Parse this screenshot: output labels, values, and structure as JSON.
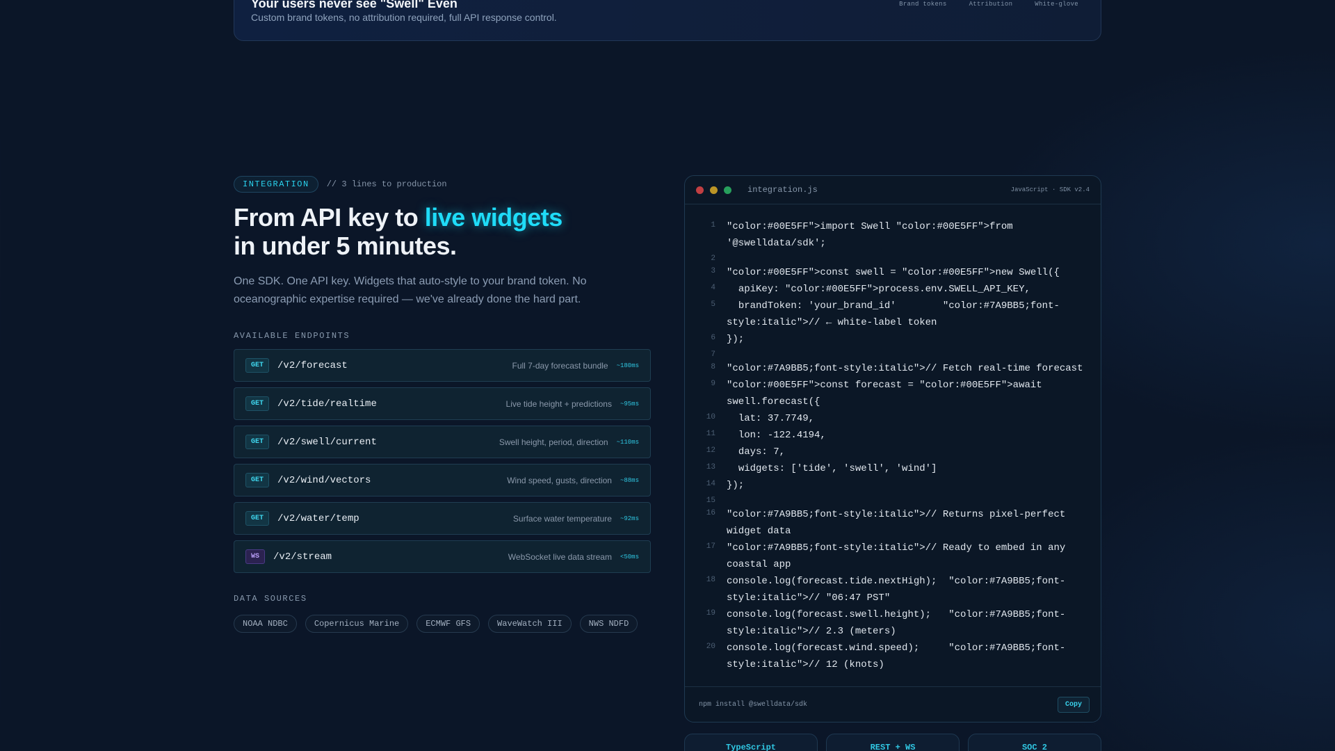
{
  "colors": {
    "background": "#0b1628",
    "accent": "#1fdcf8",
    "code_keyword": "#00E5FF",
    "code_comment": "#7A9BB5",
    "code_string": "#B7F07A",
    "code_number": "#F5C66B",
    "ws_badge": "#b79cf5"
  },
  "top_card": {
    "title": "Your users never see \"Swell\" Even",
    "subtitle": "Custom brand tokens, no attribution required, full API response control.",
    "tags": [
      "Brand tokens",
      "Attribution",
      "White-glove"
    ]
  },
  "integration": {
    "badge": "INTEGRATION",
    "note": "// 3 lines to production",
    "headline_prefix": "From API key to ",
    "headline_highlight": "live widgets",
    "headline_line2": "in under 5 minutes.",
    "lead": "One SDK. One API key. Widgets that auto-style to your brand token. No oceanographic expertise required — we've already done the hard part."
  },
  "endpoints_label": "AVAILABLE ENDPOINTS",
  "endpoints": [
    {
      "method": "GET",
      "path": "/v2/forecast",
      "desc": "Full 7-day forecast bundle",
      "latency": "~180ms"
    },
    {
      "method": "GET",
      "path": "/v2/tide/realtime",
      "desc": "Live tide height + predictions",
      "latency": "~95ms"
    },
    {
      "method": "GET",
      "path": "/v2/swell/current",
      "desc": "Swell height, period, direction",
      "latency": "~110ms"
    },
    {
      "method": "GET",
      "path": "/v2/wind/vectors",
      "desc": "Wind speed, gusts, direction",
      "latency": "~88ms"
    },
    {
      "method": "GET",
      "path": "/v2/water/temp",
      "desc": "Surface water temperature",
      "latency": "~92ms"
    },
    {
      "method": "WS",
      "path": "/v2/stream",
      "desc": "WebSocket live data stream",
      "latency": "<50ms"
    }
  ],
  "sources_label": "DATA SOURCES",
  "sources": [
    "NOAA NDBC",
    "Copernicus Marine",
    "ECMWF GFS",
    "WaveWatch III",
    "NWS NDFD"
  ],
  "code": {
    "file_name": "integration.js",
    "meta": "JavaScript · SDK v2.4",
    "lines": [
      {
        "n": "1",
        "text": "\"color:#00E5FF\">import Swell \"color:#00E5FF\">from '@swelldata/sdk';"
      },
      {
        "n": "2",
        "text": ""
      },
      {
        "n": "3",
        "text": "\"color:#00E5FF\">const swell = \"color:#00E5FF\">new Swell({"
      },
      {
        "n": "4",
        "text": "  apiKey: \"color:#00E5FF\">process.env.SWELL_API_KEY,"
      },
      {
        "n": "5",
        "text": "  brandToken: 'your_brand_id'        \"color:#7A9BB5;font-style:italic\">// ← white-label token"
      },
      {
        "n": "6",
        "text": "});"
      },
      {
        "n": "7",
        "text": ""
      },
      {
        "n": "8",
        "text": "\"color:#7A9BB5;font-style:italic\">// Fetch real-time forecast"
      },
      {
        "n": "9",
        "text": "\"color:#00E5FF\">const forecast = \"color:#00E5FF\">await swell.forecast({"
      },
      {
        "n": "10",
        "text": "  lat: 37.7749,"
      },
      {
        "n": "11",
        "text": "  lon: -122.4194,"
      },
      {
        "n": "12",
        "text": "  days: 7,"
      },
      {
        "n": "13",
        "text": "  widgets: ['tide', 'swell', 'wind']"
      },
      {
        "n": "14",
        "text": "});"
      },
      {
        "n": "15",
        "text": ""
      },
      {
        "n": "16",
        "text": "\"color:#7A9BB5;font-style:italic\">// Returns pixel-perfect widget data"
      },
      {
        "n": "17",
        "text": "\"color:#7A9BB5;font-style:italic\">// Ready to embed in any coastal app"
      },
      {
        "n": "18",
        "text": "console.log(forecast.tide.nextHigh);  \"color:#7A9BB5;font-style:italic\">// \"06:47 PST\""
      },
      {
        "n": "19",
        "text": "console.log(forecast.swell.height);   \"color:#7A9BB5;font-style:italic\">// 2.3 (meters)"
      },
      {
        "n": "20",
        "text": "console.log(forecast.wind.speed);     \"color:#7A9BB5;font-style:italic\">// 12 (knots)"
      }
    ],
    "install": "npm install @swelldata/sdk",
    "copy_label": "Copy"
  },
  "pills": [
    "TypeScript",
    "REST + WS",
    "SOC 2"
  ]
}
